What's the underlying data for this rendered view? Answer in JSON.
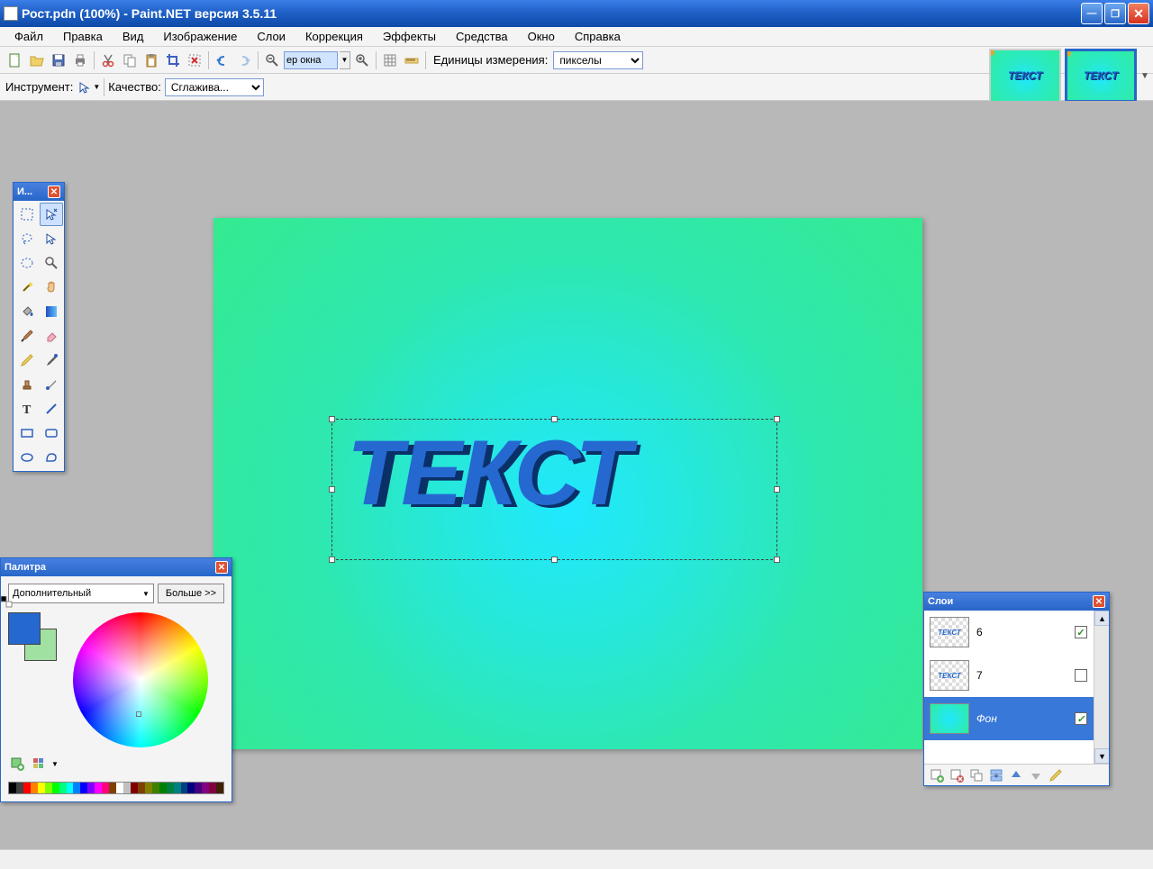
{
  "window": {
    "title": "Рост.pdn (100%) - Paint.NET версия 3.5.11"
  },
  "menu": {
    "items": [
      "Файл",
      "Правка",
      "Вид",
      "Изображение",
      "Слои",
      "Коррекция",
      "Эффекты",
      "Средства",
      "Окно",
      "Справка"
    ]
  },
  "toolbar": {
    "zoom_value": "ер окна",
    "units_label": "Единицы измерения:",
    "units_value": "пикселы"
  },
  "toolbar2": {
    "instrument_label": "Инструмент:",
    "quality_label": "Качество:",
    "quality_value": "Сглажива..."
  },
  "thumbnails": {
    "items": [
      {
        "text": "ТЕКСТ",
        "active": false
      },
      {
        "text": "ТЕКСТ",
        "active": true
      }
    ]
  },
  "canvas": {
    "text": "ТЕКСТ"
  },
  "tools_panel": {
    "title": "И..."
  },
  "color_panel": {
    "title": "Палитра",
    "mode": "Дополнительный",
    "more": "Больше >>",
    "primary": "#2568d0",
    "secondary": "#a0e0a0",
    "palette": [
      "#000000",
      "#404040",
      "#ff0000",
      "#ff8000",
      "#ffff00",
      "#80ff00",
      "#00ff00",
      "#00ff80",
      "#00ffff",
      "#0080ff",
      "#0000ff",
      "#8000ff",
      "#ff00ff",
      "#ff0080",
      "#804000",
      "#ffffff",
      "#c0c0c0",
      "#800000",
      "#804000",
      "#808000",
      "#408000",
      "#008000",
      "#008040",
      "#008080",
      "#004080",
      "#000080",
      "#400080",
      "#800080",
      "#800040",
      "#402000"
    ]
  },
  "layers_panel": {
    "title": "Слои",
    "layers": [
      {
        "name": "6",
        "visible": true,
        "type": "text"
      },
      {
        "name": "7",
        "visible": false,
        "type": "text"
      },
      {
        "name": "Фон",
        "visible": true,
        "type": "bg",
        "selected": true
      }
    ]
  }
}
